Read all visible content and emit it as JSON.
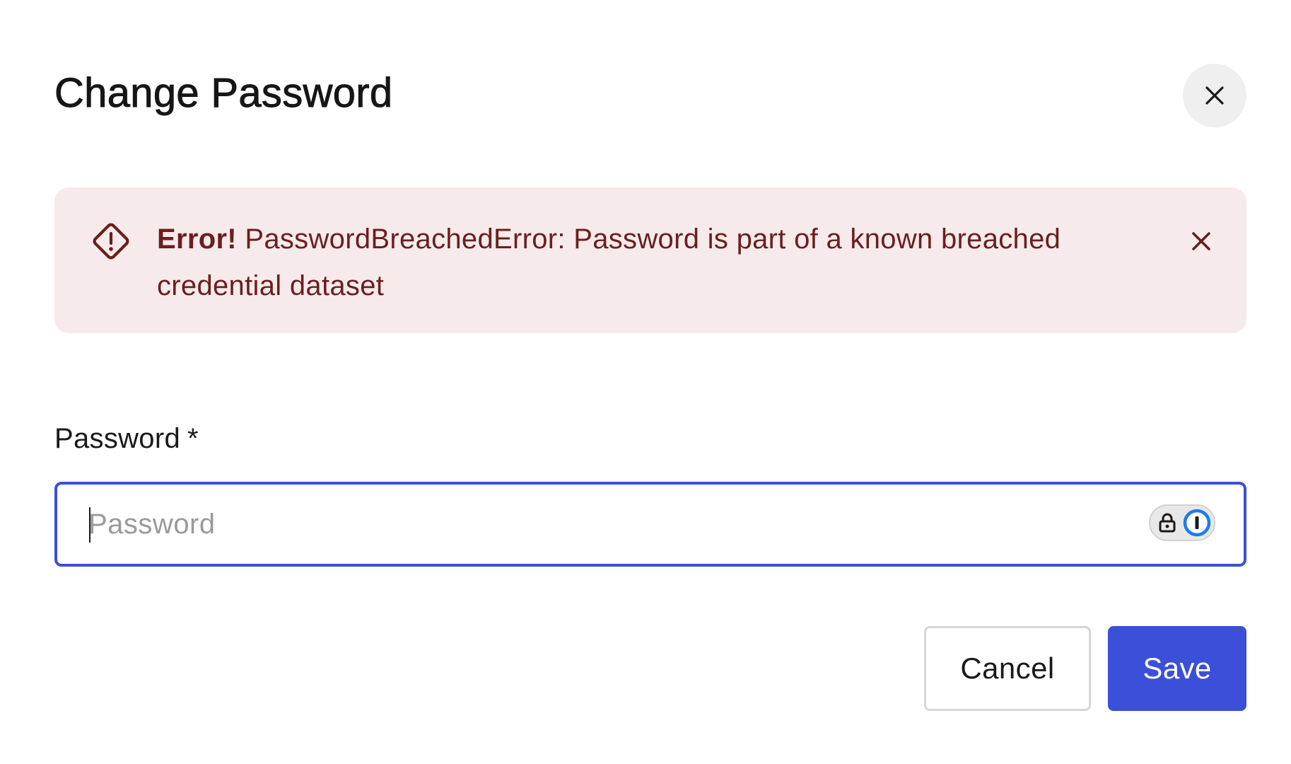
{
  "dialog": {
    "title": "Change Password",
    "close_icon": "close-icon"
  },
  "alert": {
    "icon": "warning-diamond-icon",
    "prefix": "Error!",
    "message": "PasswordBreachedError: Password is part of a known breached credential dataset",
    "dismiss_icon": "close-icon",
    "colors": {
      "background": "#f7eaea",
      "text": "#6a1f1f"
    }
  },
  "form": {
    "password": {
      "label": "Password",
      "required_marker": "*",
      "value": "",
      "placeholder": "Password",
      "password_manager_icons": [
        "lock-icon",
        "password-manager-icon"
      ]
    }
  },
  "actions": {
    "cancel_label": "Cancel",
    "save_label": "Save"
  },
  "theme": {
    "accent": "#3b4fd8"
  }
}
